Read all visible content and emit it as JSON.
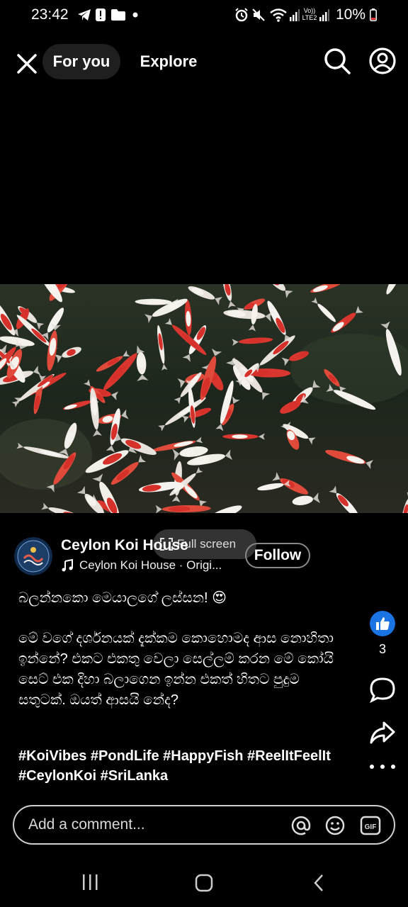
{
  "status_bar": {
    "time": "23:42",
    "network_label": "Vo)) LTE2",
    "battery": "10%",
    "icons": [
      "telegram-icon",
      "alert-icon",
      "folder-icon",
      "dot-icon",
      "alarm-icon",
      "mute-icon",
      "wifi-icon",
      "signal-icon",
      "signal-icon",
      "battery-low-icon"
    ]
  },
  "top_nav": {
    "tabs": [
      {
        "label": "For you",
        "active": true
      },
      {
        "label": "Explore",
        "active": false
      }
    ],
    "icons": [
      "close-icon",
      "search-icon",
      "profile-icon"
    ]
  },
  "video": {
    "fullscreen_label": "Full screen"
  },
  "author": {
    "name": "Ceylon Koi House",
    "audio": "Ceylon Koi House · Origi...",
    "follow_label": "Follow"
  },
  "caption": {
    "line1": "බලන්නකො මෙයාලගේ ලස්සන! 😍",
    "body": "මේ වගේ දර්ශනයක් දැක්කම කොහොමද ආස නොහිතා ඉන්නේ? එකට එකතු වෙලා සෙල්ලම් කරන මේ කෝයි සෙට් එක දිහා බලාගෙන ඉන්න එකත් හිතට පුදුම සතුටක්. ඔයත් ආසයි නේද?",
    "hashtags": "#KoiVibes #PondLife #HappyFish #ReelItFeelIt #CeylonKoi #SriLanka"
  },
  "actions": {
    "like_count": "3"
  },
  "comment_bar": {
    "placeholder": "Add a comment..."
  },
  "colors": {
    "background": "#000000",
    "like_blue": "#1b74e4"
  }
}
